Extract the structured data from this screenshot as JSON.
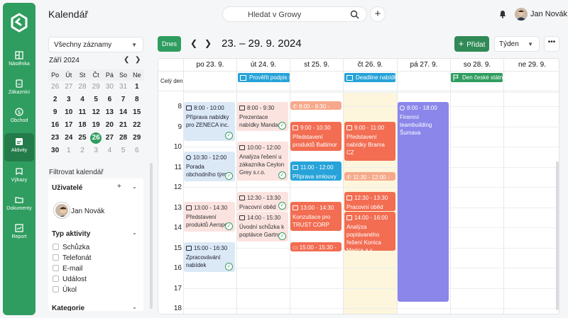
{
  "app": {
    "title": "Kalendář"
  },
  "rail": {
    "items": [
      {
        "label": "Nástěnka",
        "icon": "dashboard-icon"
      },
      {
        "label": "Zákazníci",
        "icon": "customers-icon"
      },
      {
        "label": "Obchod",
        "icon": "dollar-icon"
      },
      {
        "label": "Aktivity",
        "icon": "activities-icon"
      },
      {
        "label": "Výkazy",
        "icon": "reports-icon"
      },
      {
        "label": "Dokumenty",
        "icon": "folder-icon"
      },
      {
        "label": "Report",
        "icon": "chart-icon"
      }
    ]
  },
  "search": {
    "placeholder": "Hledat v Growy"
  },
  "user": {
    "name": "Jan Novák"
  },
  "left": {
    "filter_select": "Všechny záznamy",
    "mini_calendar": {
      "month": "Září 2024",
      "weekdays": [
        "Po",
        "Út",
        "St",
        "Čt",
        "Pá",
        "So",
        "Ne"
      ],
      "weeks": [
        [
          "26",
          "27",
          "28",
          "29",
          "30",
          "31",
          "1"
        ],
        [
          "2",
          "3",
          "4",
          "5",
          "6",
          "7",
          "8"
        ],
        [
          "9",
          "10",
          "11",
          "12",
          "13",
          "14",
          "15"
        ],
        [
          "16",
          "17",
          "18",
          "19",
          "20",
          "21",
          "22"
        ],
        [
          "23",
          "24",
          "25",
          "26",
          "27",
          "28",
          "29"
        ],
        [
          "30",
          "1",
          "2",
          "3",
          "4",
          "5",
          "6"
        ]
      ],
      "today": "26"
    },
    "filter_label": "Filtrovat kalendář",
    "users_title": "Uživatelé",
    "user_name": "Jan Novák",
    "types_title": "Typ aktivity",
    "types": [
      "Schůzka",
      "Telefonát",
      "E-mail",
      "Událost",
      "Úkol"
    ],
    "category_title": "Kategorie"
  },
  "toolbar": {
    "today": "Dnes",
    "range": "23. – 29. 9. 2024",
    "add": "Přidat",
    "view": "Týden",
    "more": "•••"
  },
  "calendar": {
    "allday_label": "Celý den",
    "days": [
      "po 23. 9.",
      "út 24. 9.",
      "st 25. 9.",
      "čt 26. 9.",
      "pá 27. 9.",
      "so 28. 9.",
      "ne 29. 9."
    ],
    "hours": [
      "8",
      "9",
      "10",
      "11",
      "12",
      "13",
      "14",
      "15",
      "16",
      "17",
      "18"
    ],
    "allday_events": [
      {
        "day": 1,
        "text": "Prověřit podpis s"
      },
      {
        "day": 3,
        "text": "Deadline nabídky"
      },
      {
        "day": 5,
        "text": "Den české státno"
      }
    ],
    "events": [
      {
        "time": "8:00 - 10:00",
        "title": "Příprava nabídky pro ZENECA inc."
      },
      {
        "time": "10:30 - 12:00",
        "title": "Porada obchodního týmu"
      },
      {
        "time": "13:00 - 14:30",
        "title": "Představení produktů Aeroport"
      },
      {
        "time": "15:00 - 16:30",
        "title": "Zpracovávání nabídek"
      },
      {
        "time": "8:00 - 9:30",
        "title": "Prezentace nabídky Mandara s.r.o."
      },
      {
        "time": "10:00 - 12:00",
        "title": "Analýza řešení u zákazníka Ceylon Grey s.r.o."
      },
      {
        "time": "12:30 - 13:30",
        "title": "Pracovní oběd"
      },
      {
        "time": "14:00 - 15:30",
        "title": "Úvodní schůzka k poptávce Gartner"
      },
      {
        "time": "8:00 - 8:30 - Domlu",
        "title": ""
      },
      {
        "time": "9:00 - 10:30",
        "title": "Představení produktů Baltimor"
      },
      {
        "time": "11:00 - 12:00",
        "title": "Příprava smlouvy"
      },
      {
        "time": "13:00 - 14:30",
        "title": "Konzultace pro TRUST CORP"
      },
      {
        "time": "15:00 - 15:30 - Po",
        "title": ""
      },
      {
        "time": "9:00 - 11:00",
        "title": "Představení nabídky Brama CZ"
      },
      {
        "time": "11:30 - 12:00 - Do",
        "title": ""
      },
      {
        "time": "12:30 - 13:30",
        "title": "Pracovní oběd"
      },
      {
        "time": "14:00 - 16:00",
        "title": "Analýza poptávaného řešení Konica Merica a.s."
      },
      {
        "time": "8:00 - 18:00",
        "title": "Firemní teambuilding Šumava"
      }
    ]
  },
  "colors": {
    "brand": "#2f9d5f",
    "today_bg": "#fdf6dc"
  }
}
